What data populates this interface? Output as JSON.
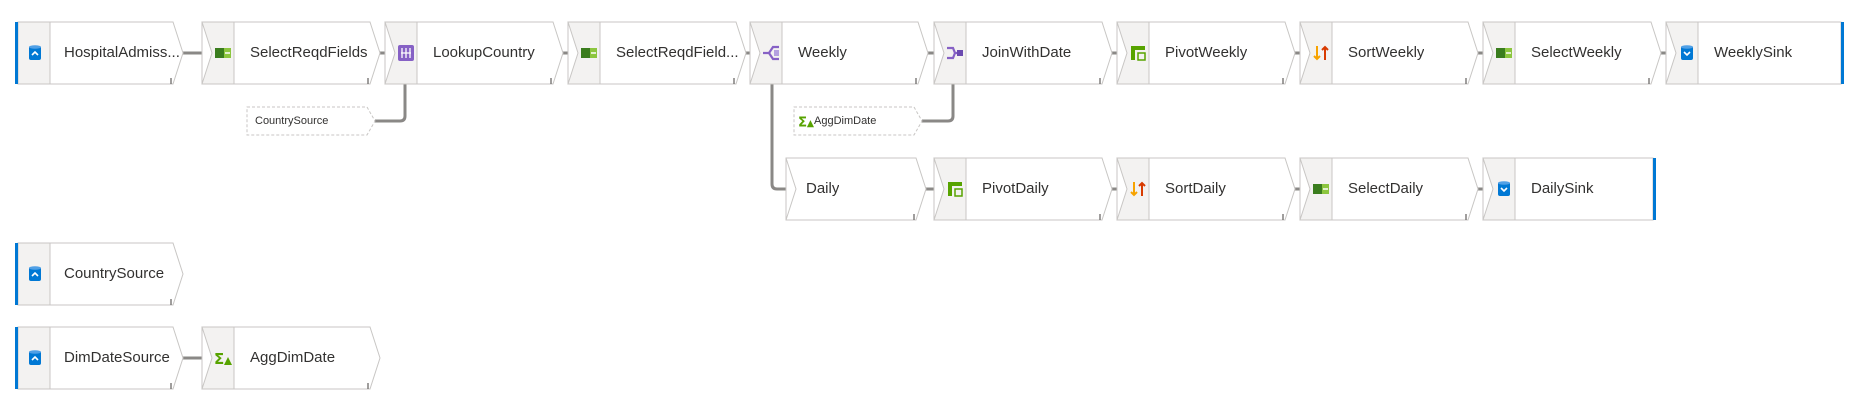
{
  "nodes": [
    {
      "id": "HospitalAdmissionsSource",
      "label": "HospitalAdmiss...",
      "icon": "source-icon",
      "kind": "source"
    },
    {
      "id": "SelectReqdFields",
      "label": "SelectReqdFields",
      "icon": "select-icon"
    },
    {
      "id": "LookupCountry",
      "label": "LookupCountry",
      "icon": "lookup-icon"
    },
    {
      "id": "SelectReqdFields2",
      "label": "SelectReqdField...",
      "icon": "select-icon"
    },
    {
      "id": "Weekly",
      "label": "Weekly",
      "icon": "conditional-split-icon"
    },
    {
      "id": "JoinWithDate",
      "label": "JoinWithDate",
      "icon": "join-icon"
    },
    {
      "id": "PivotWeekly",
      "label": "PivotWeekly",
      "icon": "pivot-icon"
    },
    {
      "id": "SortWeekly",
      "label": "SortWeekly",
      "icon": "sort-icon"
    },
    {
      "id": "SelectWeekly",
      "label": "SelectWeekly",
      "icon": "select-icon"
    },
    {
      "id": "WeeklySink",
      "label": "WeeklySink",
      "icon": "sink-icon",
      "kind": "sink"
    },
    {
      "id": "Daily",
      "label": "Daily",
      "icon": "",
      "kind": "branch"
    },
    {
      "id": "PivotDaily",
      "label": "PivotDaily",
      "icon": "pivot-icon"
    },
    {
      "id": "SortDaily",
      "label": "SortDaily",
      "icon": "sort-icon"
    },
    {
      "id": "SelectDaily",
      "label": "SelectDaily",
      "icon": "select-icon"
    },
    {
      "id": "DailySink",
      "label": "DailySink",
      "icon": "sink-icon",
      "kind": "sink"
    },
    {
      "id": "CountrySource",
      "label": "CountrySource",
      "icon": "source-icon",
      "kind": "source"
    },
    {
      "id": "DimDateSource",
      "label": "DimDateSource",
      "icon": "source-icon",
      "kind": "source"
    },
    {
      "id": "AggDimDate",
      "label": "AggDimDate",
      "icon": "aggregate-icon"
    }
  ],
  "refs": [
    {
      "id": "CountrySourceRef",
      "label": "CountrySource",
      "icon": ""
    },
    {
      "id": "AggDimDateRef",
      "label": "AggDimDate",
      "icon": "aggregate-icon"
    }
  ],
  "colors": {
    "accent": "#0078d4",
    "border": "#c8c6c4",
    "iconbg": "#f3f2f1",
    "wire": "#8a8886",
    "text": "#323130"
  }
}
